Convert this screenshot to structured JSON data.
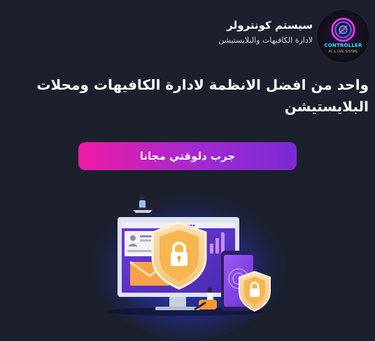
{
  "header": {
    "title": "سيستم كونترولر",
    "subtitle": "لادارة الكافيهات والبلايستيشن",
    "logo": {
      "word": "CONTROLLER",
      "sub": "PS & CAFE SYSTEMS"
    }
  },
  "hero": {
    "headline": "واحد من افضل الانظمة لادارة الكافيهات ومحلات البلايستيشن",
    "cta_label": "جرب دلوقتي مجانا"
  },
  "colors": {
    "background": "#1c1f2c",
    "cta_start": "#f01aa6",
    "cta_end": "#7a2ad4",
    "accent_purple": "#8a39e0",
    "shield_orange": "#f59a23"
  },
  "icons": {
    "logo": "gamepad-logo-icon",
    "shield": "shield-lock-icon",
    "envelope": "envelope-icon",
    "phone": "smartphone-icon"
  }
}
